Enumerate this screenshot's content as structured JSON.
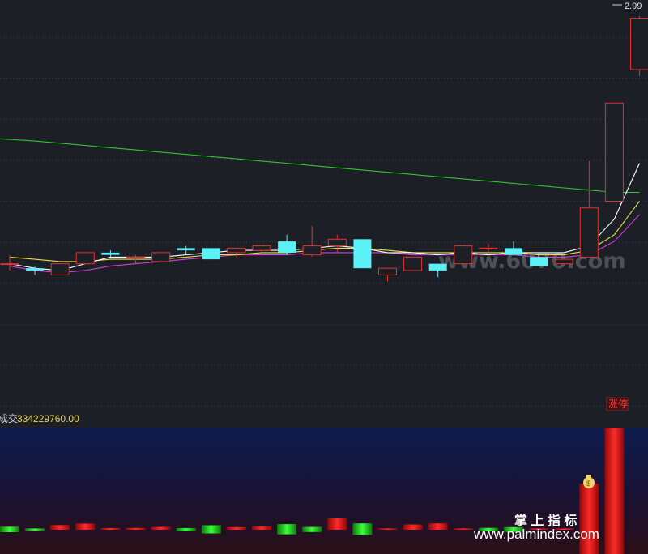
{
  "main": {
    "last_price_label": "2.99",
    "limit_up_tag": "涨停",
    "watermark": "www.6070.com"
  },
  "volume_panel": {
    "label_name": "成交:",
    "label_value": "334229760.00"
  },
  "brand": {
    "slogan": "掌 上 指 标",
    "site": "www.palmindex.com"
  },
  "colors": {
    "up": "#e2322c",
    "down": "#5cf0f7",
    "ma_white": "#ffffff",
    "ma_yellow": "#e8e04a",
    "ma_magenta": "#d33fd6",
    "ma_green": "#2ec52e",
    "grid": "#3c4150"
  },
  "chart_data": [
    {
      "type": "candlestick",
      "title": "",
      "ylabel": "",
      "ylim": [
        1.25,
        3.05
      ],
      "grid": true,
      "candles": [
        {
          "o": 1.89,
          "h": 1.93,
          "l": 1.86,
          "c": 1.89
        },
        {
          "o": 1.87,
          "h": 1.88,
          "l": 1.84,
          "c": 1.86
        },
        {
          "o": 1.84,
          "h": 1.89,
          "l": 1.84,
          "c": 1.89
        },
        {
          "o": 1.89,
          "h": 1.94,
          "l": 1.89,
          "c": 1.94
        },
        {
          "o": 1.94,
          "h": 1.95,
          "l": 1.92,
          "c": 1.93
        },
        {
          "o": 1.92,
          "h": 1.93,
          "l": 1.89,
          "c": 1.92
        },
        {
          "o": 1.9,
          "h": 1.94,
          "l": 1.9,
          "c": 1.94
        },
        {
          "o": 1.96,
          "h": 1.97,
          "l": 1.93,
          "c": 1.95
        },
        {
          "o": 1.96,
          "h": 1.96,
          "l": 1.91,
          "c": 1.91
        },
        {
          "o": 1.94,
          "h": 1.96,
          "l": 1.92,
          "c": 1.96
        },
        {
          "o": 1.95,
          "h": 1.97,
          "l": 1.94,
          "c": 1.97
        },
        {
          "o": 1.99,
          "h": 2.02,
          "l": 1.93,
          "c": 1.94
        },
        {
          "o": 1.93,
          "h": 2.06,
          "l": 1.92,
          "c": 1.97
        },
        {
          "o": 1.97,
          "h": 2.02,
          "l": 1.94,
          "c": 2.0
        },
        {
          "o": 2.0,
          "h": 2.0,
          "l": 1.87,
          "c": 1.87
        },
        {
          "o": 1.84,
          "h": 1.87,
          "l": 1.81,
          "c": 1.87
        },
        {
          "o": 1.86,
          "h": 1.92,
          "l": 1.86,
          "c": 1.92
        },
        {
          "o": 1.89,
          "h": 1.89,
          "l": 1.83,
          "c": 1.86
        },
        {
          "o": 1.89,
          "h": 1.97,
          "l": 1.89,
          "c": 1.97
        },
        {
          "o": 1.96,
          "h": 1.98,
          "l": 1.94,
          "c": 1.96
        },
        {
          "o": 1.96,
          "h": 1.99,
          "l": 1.93,
          "c": 1.93
        },
        {
          "o": 1.92,
          "h": 1.93,
          "l": 1.88,
          "c": 1.88
        },
        {
          "o": 1.89,
          "h": 1.91,
          "l": 1.88,
          "c": 1.91
        },
        {
          "o": 1.92,
          "h": 2.35,
          "l": 1.92,
          "c": 2.14
        },
        {
          "o": 2.17,
          "h": 2.61,
          "l": 2.17,
          "c": 2.61
        },
        {
          "o": 2.76,
          "h": 3.0,
          "l": 2.73,
          "c": 2.99
        }
      ],
      "ma_white": [
        1.89,
        1.87,
        1.86,
        1.89,
        1.92,
        1.92,
        1.92,
        1.93,
        1.94,
        1.95,
        1.95,
        1.95,
        1.96,
        1.97,
        1.96,
        1.94,
        1.94,
        1.93,
        1.94,
        1.93,
        1.94,
        1.94,
        1.94,
        1.97,
        2.09,
        2.34
      ],
      "ma_yellow": [
        1.92,
        1.91,
        1.9,
        1.9,
        1.91,
        1.91,
        1.91,
        1.92,
        1.93,
        1.93,
        1.94,
        1.94,
        1.95,
        1.96,
        1.96,
        1.95,
        1.94,
        1.94,
        1.94,
        1.94,
        1.94,
        1.93,
        1.93,
        1.95,
        2.02,
        2.17
      ],
      "ma_magenta": [
        1.88,
        1.86,
        1.85,
        1.86,
        1.88,
        1.89,
        1.9,
        1.91,
        1.92,
        1.93,
        1.93,
        1.93,
        1.94,
        1.94,
        1.94,
        1.94,
        1.93,
        1.93,
        1.93,
        1.93,
        1.93,
        1.92,
        1.92,
        1.93,
        1.99,
        2.11
      ],
      "ma_green": [
        2.45,
        2.44,
        2.43,
        2.42,
        2.41,
        2.4,
        2.39,
        2.38,
        2.37,
        2.36,
        2.35,
        2.34,
        2.33,
        2.32,
        2.31,
        2.3,
        2.29,
        2.28,
        2.27,
        2.26,
        2.25,
        2.24,
        2.23,
        2.22,
        2.21,
        2.21
      ]
    },
    {
      "type": "bar",
      "title": "",
      "ylabel": "",
      "ylim": [
        0,
        335000000
      ],
      "values": [
        16000000,
        7000000,
        25000000,
        33000000,
        9000000,
        10000000,
        15000000,
        9000000,
        24000000,
        14000000,
        17000000,
        30000000,
        15000000,
        61000000,
        34000000,
        5000000,
        28000000,
        34000000,
        2000000,
        10000000,
        14000000,
        6000000,
        5000000,
        170000000,
        334229760
      ],
      "directions": [
        "down",
        "down",
        "up",
        "up",
        "up",
        "up",
        "up",
        "down",
        "down",
        "up",
        "up",
        "down",
        "down",
        "up",
        "down",
        "up",
        "up",
        "up",
        "up",
        "down",
        "down",
        "up",
        "up",
        "up",
        "up"
      ]
    }
  ]
}
